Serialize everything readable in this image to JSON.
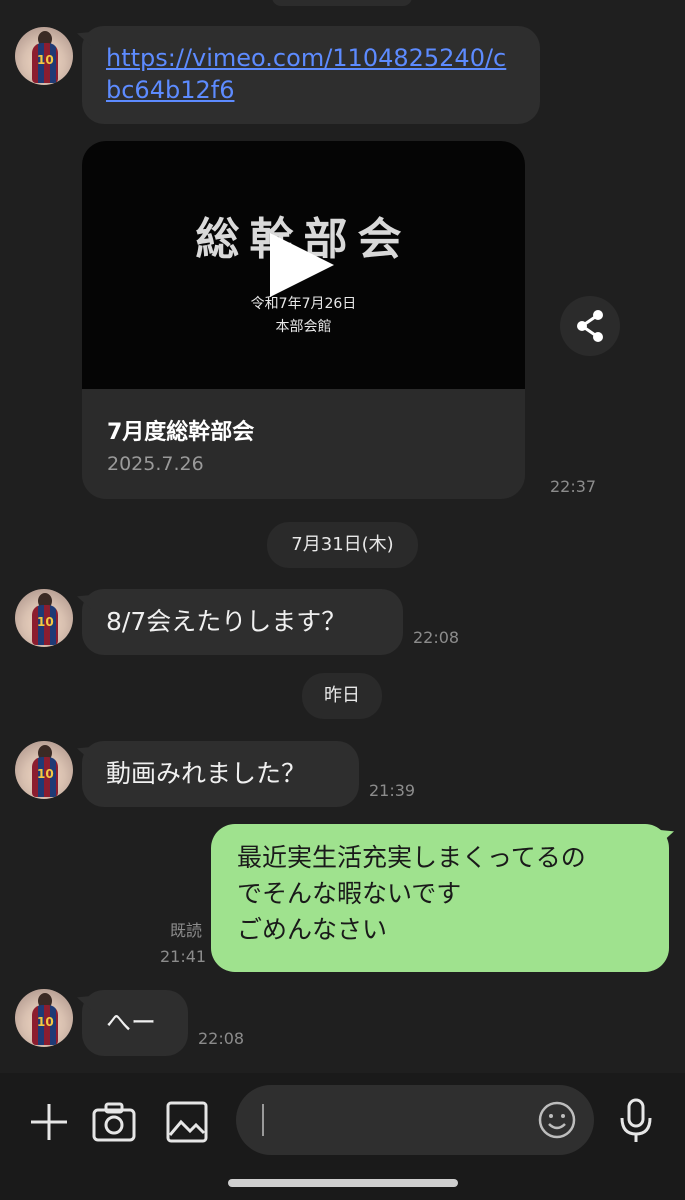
{
  "messages": {
    "link": "https://vimeo.com/1104825240/cbc64b12f6",
    "video_card": {
      "thumb_title": "総幹部会",
      "thumb_sub1": "令和7年7月26日",
      "thumb_sub2": "本部会館",
      "title": "7月度総幹部会",
      "date": "2025.7.26"
    },
    "card_time": "22:37",
    "date_divider_1": "7月31日(木)",
    "msg1_text": "8/7会えたりします？",
    "msg1_time": "22:08",
    "date_divider_2": "昨日",
    "msg2_text": "動画みれました？",
    "msg2_time": "21:39",
    "out_lines": [
      "最近実生活充実しまくってるの",
      "でそんな暇ないです",
      "ごめんなさい"
    ],
    "out_read": "既読",
    "out_time": "21:41",
    "msg3_text": "へー",
    "msg3_time": "22:08"
  },
  "avatar": {
    "jersey_number": "10"
  },
  "bottom": {
    "icons": [
      "plus-icon",
      "camera-icon",
      "image-icon",
      "emoji-icon",
      "microphone-icon"
    ]
  },
  "colors": {
    "background": "#1f1f1f",
    "incoming_bubble": "#2e2e2e",
    "outgoing_bubble": "#9fe28e",
    "link": "#5d8bff"
  }
}
